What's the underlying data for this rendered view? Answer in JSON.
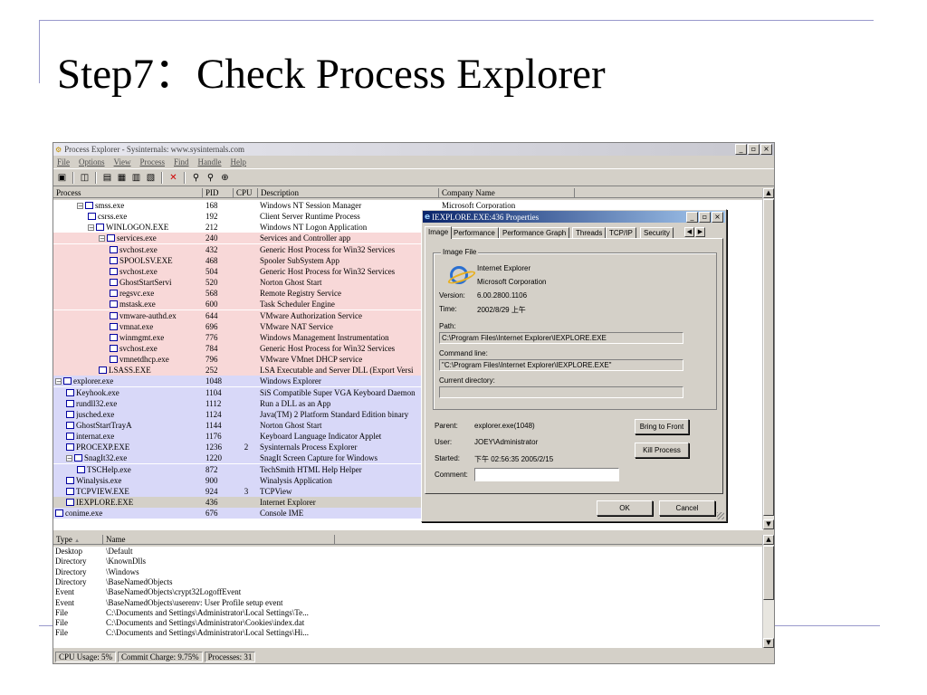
{
  "slide": {
    "title": "Step7：Check Process Explorer"
  },
  "window": {
    "title": "Process Explorer - Sysinternals: www.sysinternals.com",
    "controls": [
      "_",
      "▫",
      "×"
    ],
    "menu": [
      "File",
      "Options",
      "View",
      "Process",
      "Find",
      "Handle",
      "Help"
    ],
    "toolbar_icons": [
      "save-icon",
      "refresh-icon",
      "cpu-history-icon",
      "system-info-icon",
      "properties-icon",
      "dll-view-icon",
      "kill-process-icon",
      "find-icon",
      "find-dll-icon",
      "target-icon"
    ]
  },
  "process_columns": [
    "Process",
    "PID",
    "CPU",
    "Description",
    "Company Name"
  ],
  "processes": [
    {
      "name": "smss.exe",
      "pid": "168",
      "cpu": "",
      "desc": "Windows NT Session Manager",
      "company": "Microsoft Corporation",
      "indent": 2,
      "expand": "−",
      "color": "#ffffff"
    },
    {
      "name": "csrss.exe",
      "pid": "192",
      "cpu": "",
      "desc": "Client Server Runtime Process",
      "company": "",
      "indent": 3,
      "expand": "",
      "color": "#ffffff"
    },
    {
      "name": "WINLOGON.EXE",
      "pid": "212",
      "cpu": "",
      "desc": "Windows NT Logon Application",
      "company": "",
      "indent": 3,
      "expand": "−",
      "color": "#ffffff"
    },
    {
      "name": "services.exe",
      "pid": "240",
      "cpu": "",
      "desc": "Services and Controller app",
      "company": "",
      "indent": 4,
      "expand": "−",
      "color": "#f8d8d8"
    },
    {
      "name": "svchost.exe",
      "pid": "432",
      "cpu": "",
      "desc": "Generic Host Process for Win32 Services",
      "company": "",
      "indent": 5,
      "expand": "",
      "color": "#f8d8d8"
    },
    {
      "name": "SPOOLSV.EXE",
      "pid": "468",
      "cpu": "",
      "desc": "Spooler SubSystem App",
      "company": "",
      "indent": 5,
      "expand": "",
      "color": "#f8d8d8"
    },
    {
      "name": "svchost.exe",
      "pid": "504",
      "cpu": "",
      "desc": "Generic Host Process for Win32 Services",
      "company": "",
      "indent": 5,
      "expand": "",
      "color": "#f8d8d8"
    },
    {
      "name": "GhostStartServi",
      "pid": "520",
      "cpu": "",
      "desc": "Norton Ghost Start",
      "company": "",
      "indent": 5,
      "expand": "",
      "color": "#f8d8d8"
    },
    {
      "name": "regsvc.exe",
      "pid": "568",
      "cpu": "",
      "desc": "Remote Registry Service",
      "company": "",
      "indent": 5,
      "expand": "",
      "color": "#f8d8d8"
    },
    {
      "name": "mstask.exe",
      "pid": "600",
      "cpu": "",
      "desc": "Task Scheduler Engine",
      "company": "",
      "indent": 5,
      "expand": "",
      "color": "#f8d8d8"
    },
    {
      "name": "vmware-authd.ex",
      "pid": "644",
      "cpu": "",
      "desc": "VMware Authorization Service",
      "company": "",
      "indent": 5,
      "expand": "",
      "color": "#f8d8d8"
    },
    {
      "name": "vmnat.exe",
      "pid": "696",
      "cpu": "",
      "desc": "VMware NAT Service",
      "company": "",
      "indent": 5,
      "expand": "",
      "color": "#f8d8d8"
    },
    {
      "name": "winmgmt.exe",
      "pid": "776",
      "cpu": "",
      "desc": "Windows Management Instrumentation",
      "company": "",
      "indent": 5,
      "expand": "",
      "color": "#f8d8d8"
    },
    {
      "name": "svchost.exe",
      "pid": "784",
      "cpu": "",
      "desc": "Generic Host Process for Win32 Services",
      "company": "",
      "indent": 5,
      "expand": "",
      "color": "#f8d8d8"
    },
    {
      "name": "vmnetdhcp.exe",
      "pid": "796",
      "cpu": "",
      "desc": "VMware VMnet DHCP service",
      "company": "",
      "indent": 5,
      "expand": "",
      "color": "#f8d8d8"
    },
    {
      "name": "LSASS.EXE",
      "pid": "252",
      "cpu": "",
      "desc": "LSA Executable and Server DLL (Export Versi",
      "company": "",
      "indent": 4,
      "expand": "",
      "color": "#f8d8d8"
    },
    {
      "name": "explorer.exe",
      "pid": "1048",
      "cpu": "",
      "desc": "Windows Explorer",
      "company": "",
      "indent": 0,
      "expand": "−",
      "color": "#d8d8f8"
    },
    {
      "name": "Keyhook.exe",
      "pid": "1104",
      "cpu": "",
      "desc": "SiS Compatible Super VGA Keyboard Daemon",
      "company": "",
      "indent": 1,
      "expand": "",
      "color": "#d8d8f8"
    },
    {
      "name": "rundll32.exe",
      "pid": "1112",
      "cpu": "",
      "desc": "Run a DLL as an App",
      "company": "",
      "indent": 1,
      "expand": "",
      "color": "#d8d8f8"
    },
    {
      "name": "jusched.exe",
      "pid": "1124",
      "cpu": "",
      "desc": "Java(TM) 2 Platform Standard Edition binary",
      "company": "",
      "indent": 1,
      "expand": "",
      "color": "#d8d8f8"
    },
    {
      "name": "GhostStartTrayA",
      "pid": "1144",
      "cpu": "",
      "desc": "Norton Ghost Start",
      "company": "",
      "indent": 1,
      "expand": "",
      "color": "#d8d8f8"
    },
    {
      "name": "internat.exe",
      "pid": "1176",
      "cpu": "",
      "desc": "Keyboard Language Indicator Applet",
      "company": "",
      "indent": 1,
      "expand": "",
      "color": "#d8d8f8"
    },
    {
      "name": "PROCEXP.EXE",
      "pid": "1236",
      "cpu": "2",
      "desc": "Sysinternals Process Explorer",
      "company": "",
      "indent": 1,
      "expand": "",
      "color": "#d8d8f8"
    },
    {
      "name": "SnagIt32.exe",
      "pid": "1220",
      "cpu": "",
      "desc": "SnagIt Screen Capture for Windows",
      "company": "",
      "indent": 1,
      "expand": "−",
      "color": "#d8d8f8"
    },
    {
      "name": "TSCHelp.exe",
      "pid": "872",
      "cpu": "",
      "desc": "TechSmith HTML Help Helper",
      "company": "",
      "indent": 2,
      "expand": "",
      "color": "#d8d8f8"
    },
    {
      "name": "Winalysis.exe",
      "pid": "900",
      "cpu": "",
      "desc": "Winalysis Application",
      "company": "",
      "indent": 1,
      "expand": "",
      "color": "#d8d8f8"
    },
    {
      "name": "TCPVIEW.EXE",
      "pid": "924",
      "cpu": "3",
      "desc": "TCPView",
      "company": "",
      "indent": 1,
      "expand": "",
      "color": "#d8d8f8"
    },
    {
      "name": "IEXPLORE.EXE",
      "pid": "436",
      "cpu": "",
      "desc": "Internet Explorer",
      "company": "",
      "indent": 1,
      "expand": "",
      "color": "#d4d0c8"
    },
    {
      "name": "conime.exe",
      "pid": "676",
      "cpu": "",
      "desc": "Console IME",
      "company": "",
      "indent": 0,
      "expand": "",
      "color": "#d8d8f8"
    }
  ],
  "handle_columns": [
    "Type",
    "Name"
  ],
  "handles": [
    {
      "type": "Desktop",
      "name": "\\Default"
    },
    {
      "type": "Directory",
      "name": "\\KnownDlls"
    },
    {
      "type": "Directory",
      "name": "\\Windows"
    },
    {
      "type": "Directory",
      "name": "\\BaseNamedObjects"
    },
    {
      "type": "Event",
      "name": "\\BaseNamedObjects\\crypt32LogoffEvent"
    },
    {
      "type": "Event",
      "name": "\\BaseNamedObjects\\userenv:  User Profile setup event"
    },
    {
      "type": "File",
      "name": "C:\\Documents and Settings\\Administrator\\Local Settings\\Te..."
    },
    {
      "type": "File",
      "name": "C:\\Documents and Settings\\Administrator\\Cookies\\index.dat"
    },
    {
      "type": "File",
      "name": "C:\\Documents and Settings\\Administrator\\Local Settings\\Hi..."
    }
  ],
  "status": {
    "cpu": "CPU Usage: 5%",
    "commit": "Commit Charge: 9.75%",
    "processes": "Processes: 31"
  },
  "dialog": {
    "title": "IEXPLORE.EXE:436 Properties",
    "tabs": [
      "Image",
      "Performance",
      "Performance Graph",
      "Threads",
      "TCP/IP",
      "Security"
    ],
    "image_file_label": "Image File",
    "product": "Internet Explorer",
    "company": "Microsoft Corporation",
    "version_label": "Version:",
    "version": "6.00.2800.1106",
    "time_label": "Time:",
    "time": "2002/8/29 上午",
    "path_label": "Path:",
    "path": "C:\\Program Files\\Internet Explorer\\IEXPLORE.EXE",
    "cmdline_label": "Command line:",
    "cmdline": "\"C:\\Program Files\\Internet Explorer\\IEXPLORE.EXE\"",
    "curdir_label": "Current directory:",
    "curdir": "",
    "parent_label": "Parent:",
    "parent": "explorer.exe(1048)",
    "user_label": "User:",
    "user": "JOEY\\Administrator",
    "started_label": "Started:",
    "started": "下午 02:56:35   2005/2/15",
    "comment_label": "Comment:",
    "comment": "",
    "bring_to_front": "Bring to Front",
    "kill_process": "Kill Process",
    "ok": "OK",
    "cancel": "Cancel"
  }
}
